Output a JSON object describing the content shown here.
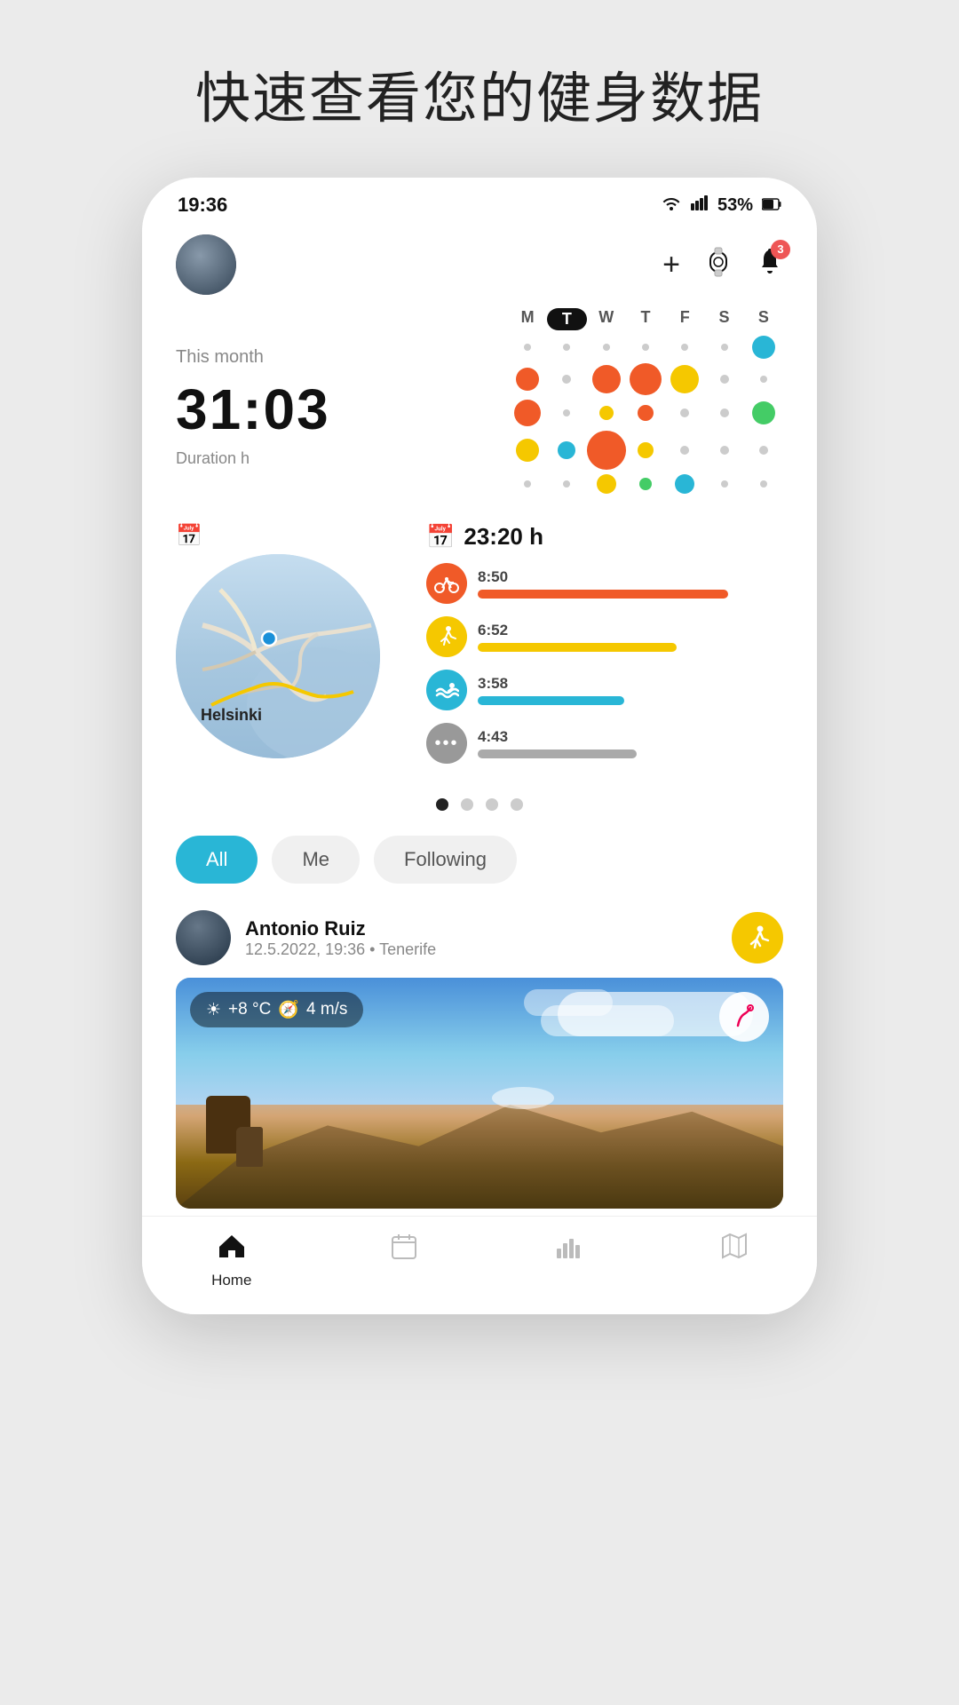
{
  "page": {
    "title": "快速查看您的健身数据",
    "bg_color": "#ebebeb"
  },
  "status_bar": {
    "time": "19:36",
    "wifi": "wifi",
    "signal": "signal",
    "battery": "53%"
  },
  "top_nav": {
    "add_label": "+",
    "watch_label": "⌚",
    "bell_badge": "3"
  },
  "stats": {
    "this_month_label": "This month",
    "time_value": "31:03",
    "duration_label": "Duration h"
  },
  "calendar": {
    "headers": [
      "M",
      "T",
      "W",
      "T",
      "F",
      "S",
      "S"
    ],
    "today_index": 1
  },
  "activity_section": {
    "map_city": "Helsinki",
    "calendar_icon": "📅",
    "total_label": "23:20 h",
    "items": [
      {
        "time": "8:50",
        "color": "#f05a28",
        "bar_width": "82%",
        "icon": "🚴"
      },
      {
        "time": "6:52",
        "color": "#f5c800",
        "bar_width": "65%",
        "icon": "🏃"
      },
      {
        "time": "3:58",
        "color": "#29b6d6",
        "bar_width": "48%",
        "icon": "🏊"
      },
      {
        "time": "4:43",
        "color": "#999",
        "bar_width": "52%",
        "icon": "•••"
      }
    ]
  },
  "page_dots": [
    true,
    false,
    false,
    false
  ],
  "filter_pills": [
    {
      "label": "All",
      "active": true
    },
    {
      "label": "Me",
      "active": false
    },
    {
      "label": "Following",
      "active": false
    }
  ],
  "post": {
    "user_name": "Antonio Ruiz",
    "meta": "12.5.2022, 19:36 • Tenerife",
    "weather": "+8 °C",
    "wind": "4 m/s"
  },
  "bottom_nav": [
    {
      "label": "Home",
      "icon": "home",
      "active": true
    },
    {
      "label": "",
      "icon": "calendar",
      "active": false
    },
    {
      "label": "",
      "icon": "chart",
      "active": false
    },
    {
      "label": "",
      "icon": "map",
      "active": false
    }
  ]
}
